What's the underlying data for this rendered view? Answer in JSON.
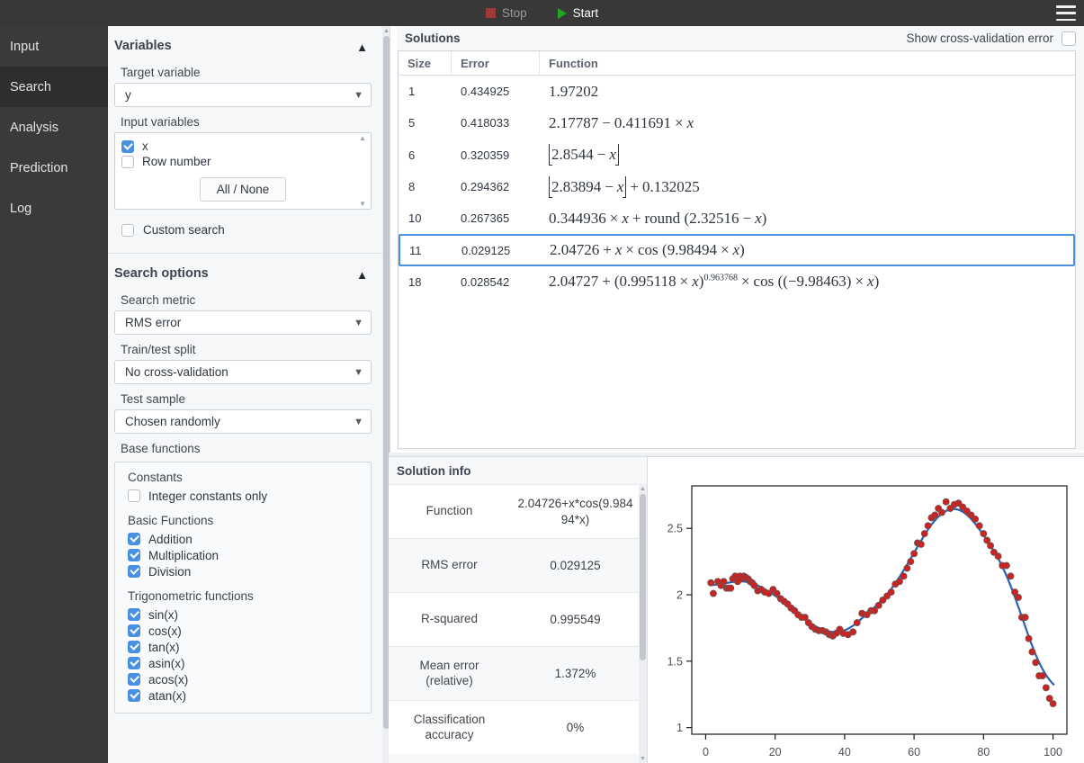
{
  "topbar": {
    "stop_label": "Stop",
    "start_label": "Start",
    "menu_icon": "hamburger-menu-icon"
  },
  "nav": {
    "items": [
      {
        "label": "Input",
        "active": false
      },
      {
        "label": "Search",
        "active": true
      },
      {
        "label": "Analysis",
        "active": false
      },
      {
        "label": "Prediction",
        "active": false
      },
      {
        "label": "Log",
        "active": false
      }
    ]
  },
  "variables": {
    "section_title": "Variables",
    "collapse_icon": "chevron-up-icon",
    "target_label": "Target variable",
    "target_value": "y",
    "input_label": "Input variables",
    "inputs": [
      {
        "label": "x",
        "checked": true
      },
      {
        "label": "Row number",
        "checked": false
      }
    ],
    "all_none_label": "All / None",
    "custom_search_label": "Custom search",
    "custom_search_checked": false
  },
  "search_options": {
    "section_title": "Search options",
    "collapse_icon": "chevron-up-icon",
    "metric_label": "Search metric",
    "metric_value": "RMS error",
    "split_label": "Train/test split",
    "split_value": "No cross-validation",
    "test_sample_label": "Test sample",
    "test_sample_value": "Chosen randomly",
    "base_functions_label": "Base functions",
    "constants_group": "Constants",
    "integer_constants_label": "Integer constants only",
    "integer_constants_checked": false,
    "basic_group": "Basic Functions",
    "basic": [
      {
        "label": "Addition",
        "checked": true
      },
      {
        "label": "Multiplication",
        "checked": true
      },
      {
        "label": "Division",
        "checked": true
      }
    ],
    "trig_group": "Trigonometric functions",
    "trig": [
      {
        "label": "sin(x)",
        "checked": true
      },
      {
        "label": "cos(x)",
        "checked": true
      },
      {
        "label": "tan(x)",
        "checked": true
      },
      {
        "label": "asin(x)",
        "checked": true
      },
      {
        "label": "acos(x)",
        "checked": true
      },
      {
        "label": "atan(x)",
        "checked": true
      }
    ]
  },
  "solutions": {
    "title": "Solutions",
    "cross_validation_label": "Show cross-validation error",
    "cross_validation_checked": false,
    "columns": [
      "Size",
      "Error",
      "Function"
    ],
    "rows": [
      {
        "size": "1",
        "error": "0.434925",
        "selected": false
      },
      {
        "size": "5",
        "error": "0.418033",
        "selected": false
      },
      {
        "size": "6",
        "error": "0.320359",
        "selected": false
      },
      {
        "size": "8",
        "error": "0.294362",
        "selected": false
      },
      {
        "size": "10",
        "error": "0.267365",
        "selected": false
      },
      {
        "size": "11",
        "error": "0.029125",
        "selected": true
      },
      {
        "size": "18",
        "error": "0.028542",
        "selected": false
      }
    ],
    "functions_plain": [
      "1.97202",
      "2.17787 - 0.411691 * x",
      "floor(2.8544 - x)",
      "floor(2.83894 - x) + 0.132025",
      "0.344936 * x + round(2.32516 - x)",
      "2.04726 + x * cos(9.98494 * x)",
      "2.04727 + (0.995118 * x)^0.963768 * cos((-9.98463) * x)"
    ]
  },
  "solution_info": {
    "title": "Solution info",
    "rows": [
      {
        "key": "Function",
        "value": "2.04726+x*cos(9.98494*x)"
      },
      {
        "key": "RMS error",
        "value": "0.029125"
      },
      {
        "key": "R-squared",
        "value": "0.995549"
      },
      {
        "key": "Mean error\n(relative)",
        "value": "1.372%"
      },
      {
        "key": "Classification\naccuracy",
        "value": "0%"
      }
    ],
    "row_keys": {
      "r0": "Function",
      "r1": "RMS error",
      "r2": "R-squared",
      "r3a": "Mean error",
      "r3b": "(relative)",
      "r4a": "Classification",
      "r4b": "accuracy"
    },
    "row_values": {
      "r0": "2.04726+x*cos(9.98494*x)",
      "r1": "0.029125",
      "r2": "0.995549",
      "r3": "1.372%",
      "r4": "0%"
    }
  },
  "colors": {
    "accent_blue": "#4a90e2",
    "curve_blue": "#2c5fb5",
    "point_red": "#cc2222",
    "topbar_dark": "#383838",
    "nav_dark": "#3a3a3a",
    "panel_bg": "#f6f7f9",
    "start_green": "#1fa81f",
    "stop_red": "#9e3b36"
  },
  "chart_data": {
    "type": "scatter",
    "title": "",
    "xlabel": "",
    "ylabel": "",
    "xlim": [
      -4,
      104
    ],
    "ylim": [
      0.95,
      2.82
    ],
    "xticks": [
      0,
      20,
      40,
      60,
      80,
      100
    ],
    "yticks": [
      1,
      1.5,
      2,
      2.5
    ],
    "grid": false,
    "legend": "none",
    "series": [
      {
        "name": "data",
        "type": "scatter",
        "color": "#cc2222",
        "x": [
          1.5,
          2.2,
          3.5,
          4.4,
          5.2,
          6.0,
          6.6,
          7.2,
          7.8,
          8.5,
          9.2,
          9.8,
          10.4,
          11.0,
          11.6,
          12.2,
          12.8,
          13.4,
          14.0,
          15.0,
          16.0,
          17.0,
          18.2,
          19.4,
          20.5,
          21.6,
          22.6,
          23.6,
          24.6,
          25.6,
          26.6,
          27.6,
          28.6,
          29.6,
          30.6,
          31.6,
          32.6,
          33.6,
          34.6,
          35.6,
          36.6,
          37.6,
          38.6,
          39.6,
          41.0,
          42.4,
          43.6,
          45.0,
          46.4,
          47.6,
          48.6,
          49.8,
          51.0,
          52.2,
          53.4,
          54.6,
          55.8,
          57.0,
          58.0,
          59.0,
          60.0,
          61.0,
          62.0,
          63.0,
          64.0,
          65.0,
          66.0,
          67.0,
          68.0,
          69.2,
          70.4,
          71.6,
          72.8,
          74.0,
          75.2,
          76.4,
          77.6,
          78.8,
          80.0,
          81.0,
          82.0,
          83.0,
          84.2,
          85.4,
          86.6,
          87.8,
          89.0,
          90.0,
          91.0,
          92.0,
          93.0,
          94.0,
          95.0,
          96.0,
          97.0,
          98.0,
          99.0,
          100.0
        ],
        "y": [
          2.09,
          2.01,
          2.1,
          2.07,
          2.1,
          2.05,
          2.05,
          2.05,
          2.12,
          2.14,
          2.1,
          2.14,
          2.12,
          2.14,
          2.13,
          2.12,
          2.1,
          2.09,
          2.07,
          2.03,
          2.04,
          2.02,
          2.01,
          2.04,
          2.01,
          1.97,
          1.95,
          1.93,
          1.9,
          1.88,
          1.85,
          1.83,
          1.83,
          1.79,
          1.76,
          1.74,
          1.73,
          1.73,
          1.72,
          1.7,
          1.69,
          1.71,
          1.74,
          1.71,
          1.7,
          1.72,
          1.79,
          1.86,
          1.85,
          1.88,
          1.88,
          1.92,
          1.96,
          1.99,
          2.02,
          2.08,
          2.1,
          2.14,
          2.2,
          2.25,
          2.31,
          2.39,
          2.38,
          2.46,
          2.52,
          2.58,
          2.6,
          2.65,
          2.62,
          2.7,
          2.65,
          2.68,
          2.69,
          2.66,
          2.63,
          2.6,
          2.57,
          2.52,
          2.46,
          2.41,
          2.37,
          2.32,
          2.29,
          2.22,
          2.22,
          2.14,
          2.02,
          1.98,
          1.83,
          1.83,
          1.67,
          1.57,
          1.49,
          1.39,
          1.39,
          1.3,
          1.22,
          1.18
        ],
        "marker": "circle",
        "marker_size": 6
      },
      {
        "name": "fit",
        "type": "line",
        "color": "#2c5fb5",
        "line_width": 2.2,
        "formula": "2.04726 + x*cos(9.98494*x)"
      }
    ]
  }
}
